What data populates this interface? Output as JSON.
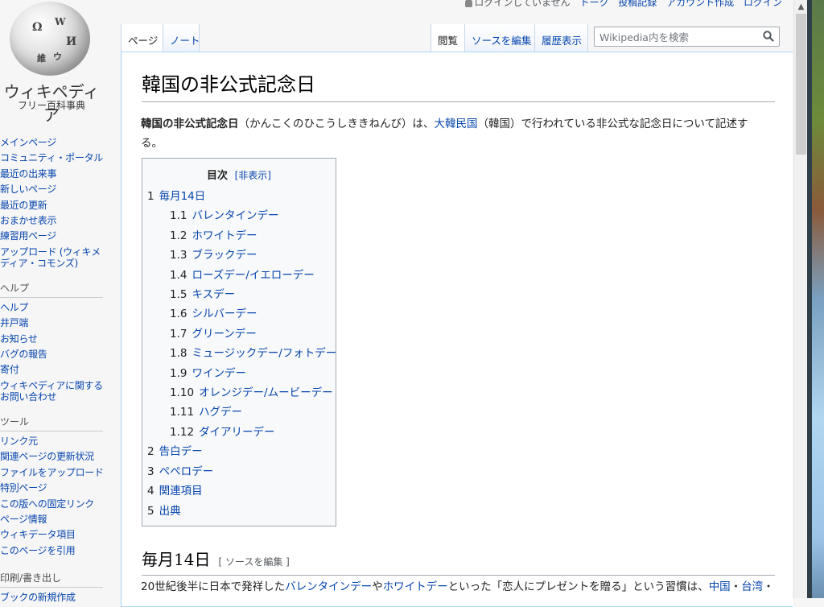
{
  "logo": {
    "wordmark": "ウィキペディア",
    "tagline": "フリー百科事典",
    "glyphs": [
      "W",
      "Ω",
      "И",
      "維",
      "ウ"
    ]
  },
  "personal": {
    "items": [
      "ログインしていません",
      "トーク",
      "投稿記録",
      "アカウント作成",
      "ログイン"
    ]
  },
  "tabs": {
    "left": [
      "ページ",
      "ノート"
    ],
    "right": [
      "閲覧",
      "ソースを編集",
      "履歴表示"
    ]
  },
  "search": {
    "placeholder": "Wikipedia内を検索",
    "icon": "search-icon"
  },
  "sidebar": {
    "nav": [
      "メインページ",
      "コミュニティ・ポータル",
      "最近の出来事",
      "新しいページ",
      "最近の更新",
      "おまかせ表示",
      "練習用ページ",
      "アップロード (ウィキメディア・コモンズ)"
    ],
    "help_heading": "ヘルプ",
    "help": [
      "ヘルプ",
      "井戸端",
      "お知らせ",
      "バグの報告",
      "寄付",
      "ウィキペディアに関するお問い合わせ"
    ],
    "tools_heading": "ツール",
    "tools": [
      "リンク元",
      "関連ページの更新状況",
      "ファイルをアップロード",
      "特別ページ",
      "この版への固定リンク",
      "ページ情報",
      "ウィキデータ項目",
      "このページを引用"
    ],
    "print_heading": "印刷/書き出し",
    "print": [
      "ブックの新規作成"
    ]
  },
  "article": {
    "title": "韓国の非公式記念日",
    "lead": {
      "bold": "韓国の非公式記念日",
      "reading": "（かんこくのひこうしききねんび）は、",
      "link1": "大韓民国",
      "mid": "（韓国）で行われている非公式な記念日について記述する。"
    },
    "toc": {
      "title": "目次",
      "toggle": "[非表示]",
      "items": [
        {
          "num": "1",
          "label": "毎月14日",
          "level": 1
        },
        {
          "num": "1.1",
          "label": "バレンタインデー",
          "level": 2
        },
        {
          "num": "1.2",
          "label": "ホワイトデー",
          "level": 2
        },
        {
          "num": "1.3",
          "label": "ブラックデー",
          "level": 2
        },
        {
          "num": "1.4",
          "label": "ローズデー/イエローデー",
          "level": 2
        },
        {
          "num": "1.5",
          "label": "キスデー",
          "level": 2
        },
        {
          "num": "1.6",
          "label": "シルバーデー",
          "level": 2
        },
        {
          "num": "1.7",
          "label": "グリーンデー",
          "level": 2
        },
        {
          "num": "1.8",
          "label": "ミュージックデー/フォトデー",
          "level": 2
        },
        {
          "num": "1.9",
          "label": "ワインデー",
          "level": 2
        },
        {
          "num": "1.10",
          "label": "オレンジデー/ムービーデー",
          "level": 2
        },
        {
          "num": "1.11",
          "label": "ハグデー",
          "level": 2
        },
        {
          "num": "1.12",
          "label": "ダイアリーデー",
          "level": 2
        },
        {
          "num": "2",
          "label": "告白デー",
          "level": 1
        },
        {
          "num": "3",
          "label": "ペペロデー",
          "level": 1
        },
        {
          "num": "4",
          "label": "関連項目",
          "level": 1
        },
        {
          "num": "5",
          "label": "出典",
          "level": 1
        }
      ]
    },
    "section1": {
      "title": "毎月14日",
      "edit": "[ ソースを編集 ]"
    },
    "para1": {
      "t1": "20世紀後半に日本で発祥した",
      "l1": "バレンタインデー",
      "t2": "や",
      "l2": "ホワイトデー",
      "t3": "といった「恋人にプレゼントを贈る」という習慣は、",
      "l3": "中国",
      "t4": "・",
      "l4": "台湾",
      "t5": "・"
    }
  }
}
